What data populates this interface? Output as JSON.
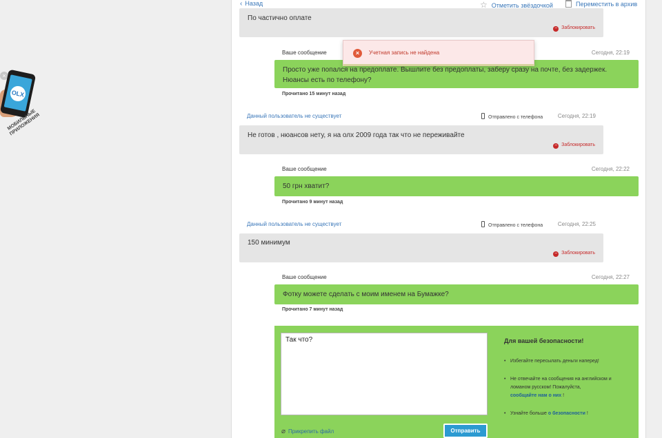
{
  "promo": {
    "close": "×",
    "logo": "OLX",
    "caption": "МОБИЛЬНЫЕ ПРИЛОЖЕНИЯ"
  },
  "topbar": {
    "back": "Назад",
    "star": "Отметить звёздочкой",
    "archive": "Переместить в архив"
  },
  "toast": {
    "text": "Учетная запись не найдена"
  },
  "labels": {
    "your_message": "Ваше сообщение",
    "user_missing": "Данный пользователь не существует",
    "from_phone": "Отправлено с телефона",
    "block": "Заблокировать"
  },
  "messages": [
    {
      "dir": "in",
      "text": "По частично оплате"
    },
    {
      "dir": "out",
      "time": "Сегодня, 22:19",
      "text": "Просто уже попался на предоплате. Вышлите без предоплаты, заберу сразу на почте, без задержек. Нюансы есть по телефону?",
      "read": "Прочитано 15 минут назад"
    },
    {
      "dir": "in",
      "time": "Сегодня, 22:19",
      "text": "Не готов , нюансов нету, я на олх 2009 года так что не переживайте"
    },
    {
      "dir": "out",
      "time": "Сегодня, 22:22",
      "text": "50 грн хватит?",
      "read": "Прочитано 9 минут назад"
    },
    {
      "dir": "in",
      "time": "Сегодня, 22:25",
      "text": "150 минимум"
    },
    {
      "dir": "out",
      "time": "Сегодня, 22:27",
      "text": "Фотку можете сделать с моим именем на Бумажке?",
      "read": "Прочитано 7 минут назад"
    }
  ],
  "compose": {
    "value": "Так что?",
    "attach": "Прикрепить файл",
    "send": "Отправить"
  },
  "safety": {
    "title": "Для вашей безопасности!",
    "item1": "Избегайте пересылать деньги наперед!",
    "item2_text": "Не отвечайте на сообщения на английском и ломаном русском! Пожалуйста,",
    "item2_link": "сообщайте нам о них",
    "item2_end": "!",
    "item3_text": "Узнайте больше",
    "item3_link": "о безопасности",
    "item3_end": "!"
  }
}
